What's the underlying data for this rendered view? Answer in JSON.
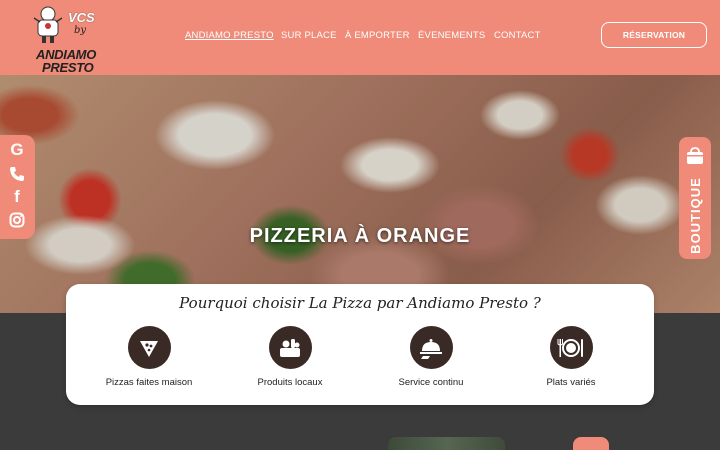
{
  "header": {
    "logo": {
      "vcs": "VCS",
      "by": "by",
      "line1": "ANDIAMO",
      "line2": "PRESTO"
    },
    "nav": [
      {
        "label": "ANDIAMO PRESTO",
        "active": true
      },
      {
        "label": "SUR PLACE"
      },
      {
        "label": "À EMPORTER"
      },
      {
        "label": "ÉVENEMENTS"
      },
      {
        "label": "CONTACT"
      }
    ],
    "reservation_label": "RÉSERVATION"
  },
  "hero": {
    "title": "PIZZERIA À ORANGE"
  },
  "social": [
    "google-icon",
    "phone-icon",
    "facebook-icon",
    "instagram-icon"
  ],
  "boutique": {
    "label": "BOUTIQUE"
  },
  "why": {
    "title": "Pourquoi choisir La Pizza par Andiamo Presto ?",
    "features": [
      {
        "icon": "pizza-slice-icon",
        "label": "Pizzas faites maison"
      },
      {
        "icon": "local-produce-icon",
        "label": "Produits locaux"
      },
      {
        "icon": "cloche-service-icon",
        "label": "Service continu"
      },
      {
        "icon": "plate-cutlery-icon",
        "label": "Plats variés"
      }
    ]
  },
  "colors": {
    "accent": "#ef8b78",
    "dark": "#3b3b3b",
    "icon_bg": "#3a2a26"
  }
}
